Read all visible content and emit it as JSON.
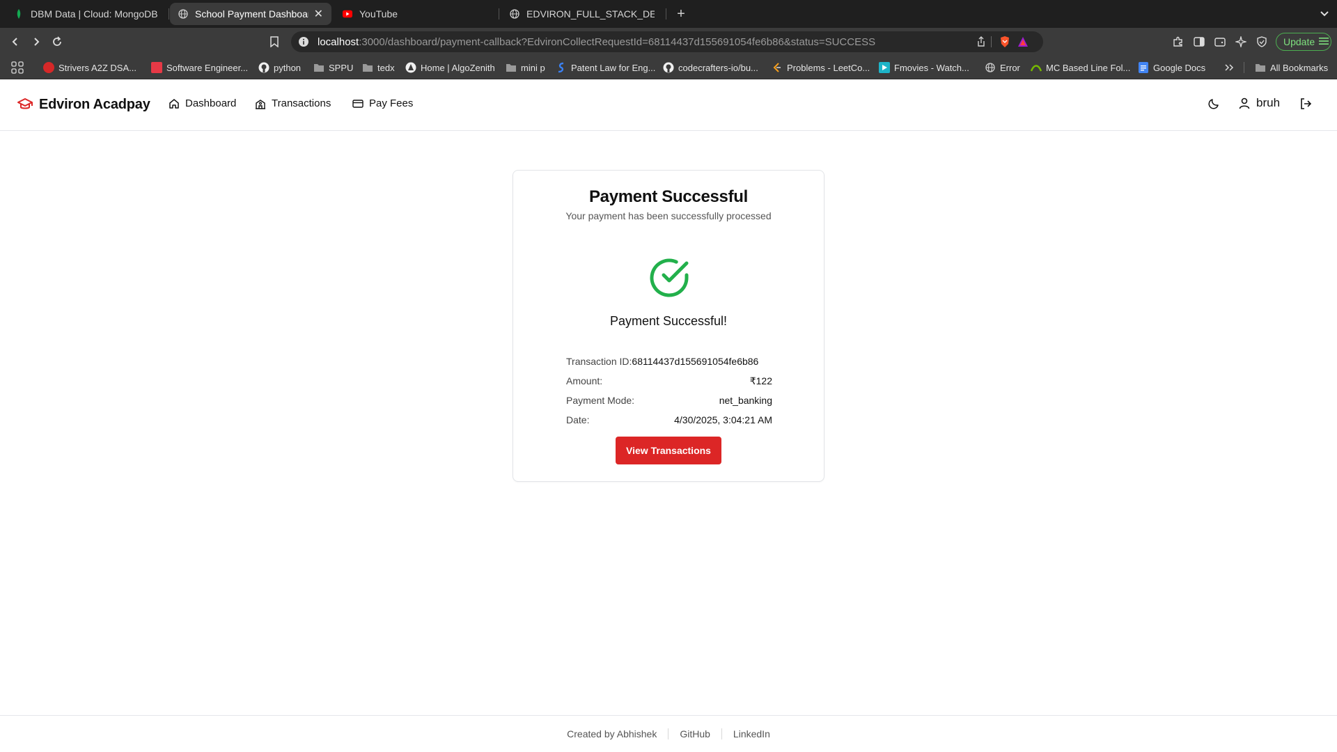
{
  "browser": {
    "tabs": [
      {
        "title": "DBM Data | Cloud: MongoDB Cloud",
        "active": false
      },
      {
        "title": "School Payment Dashboard",
        "active": true
      },
      {
        "title": "YouTube",
        "active": false
      },
      {
        "title": "EDVIRON_FULL_STACK_DEVELOPER",
        "active": false
      }
    ],
    "url": {
      "host": "localhost",
      "rest": ":3000/dashboard/payment-callback?EdvironCollectRequestId=68114437d155691054fe6b86&status=SUCCESS"
    },
    "update_label": "Update",
    "bookmarks": [
      "Strivers A2Z DSA...",
      "Software Engineer...",
      "python",
      "SPPU",
      "tedx",
      "Home | AlgoZenith",
      "mini p",
      "Patent Law for Eng...",
      "codecrafters-io/bu...",
      "Problems - LeetCo...",
      "Fmovies - Watch...",
      "Error",
      "MC Based Line Fol...",
      "Google Docs"
    ],
    "all_bookmarks": "All Bookmarks",
    "colors": {
      "tabbar": "#1f1f1f",
      "toolbar": "#3b3b3b",
      "update": "#4caf50"
    }
  },
  "app": {
    "brand": "Edviron Acadpay",
    "nav": {
      "dashboard": "Dashboard",
      "transactions": "Transactions",
      "pay_fees": "Pay Fees"
    },
    "user": "bruh",
    "colors": {
      "accent": "#dc2626",
      "success": "#22b04b"
    }
  },
  "card": {
    "title": "Payment Successful",
    "subtitle": "Your payment has been successfully processed",
    "status_heading": "Payment Successful!",
    "details": {
      "transaction_id_label": "Transaction ID:",
      "transaction_id": "68114437d155691054fe6b86",
      "amount_label": "Amount:",
      "amount": "₹122",
      "mode_label": "Payment Mode:",
      "mode": "net_banking",
      "date_label": "Date:",
      "date": "4/30/2025, 3:04:21 AM"
    },
    "button_label": "View Transactions"
  },
  "footer": {
    "created_by": "Created by Abhishek",
    "github": "GitHub",
    "linkedin": "LinkedIn"
  }
}
